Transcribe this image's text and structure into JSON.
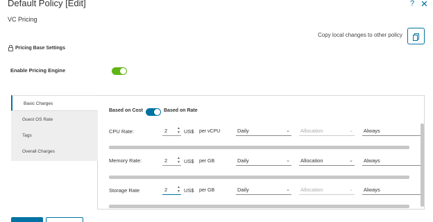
{
  "header": {
    "title": "Default Policy [Edit]",
    "help_icon": "?",
    "close_icon": "✕"
  },
  "subtitle": "VC Pricing",
  "copy": {
    "label": "Copy local changes to other policy",
    "icon": "copy-icon"
  },
  "section_title": "Pricing Base Settings",
  "enable_engine": {
    "label": "Enable Pricing Engine",
    "on": true
  },
  "nav": {
    "items": [
      {
        "label": "Basic Charges",
        "active": true
      },
      {
        "label": "Guest OS Rate"
      },
      {
        "label": "Tags"
      },
      {
        "label": "Overall Charges"
      }
    ]
  },
  "mode": {
    "left_label": "Based on Cost",
    "right_label": "Based on Rate"
  },
  "rows": [
    {
      "label": "CPU Rate:",
      "value": "2",
      "unit": "US$",
      "per": "per vCPU",
      "period": "Daily",
      "allocation": "Allocation",
      "allocation_disabled": true,
      "when": "Always"
    },
    {
      "label": "Memory Rate:",
      "value": "2",
      "unit": "US$",
      "per": "per GB",
      "period": "Daily",
      "allocation": "Allocation",
      "allocation_disabled": false,
      "when": "Always"
    },
    {
      "label": "Storage Rate",
      "value": "2",
      "unit": "US$",
      "per": "per GB",
      "period": "Daily",
      "allocation": "Allocation",
      "allocation_disabled": true,
      "when": "Always"
    }
  ],
  "colors": {
    "accent": "#0072a3",
    "toggle_on": "#60b515"
  }
}
